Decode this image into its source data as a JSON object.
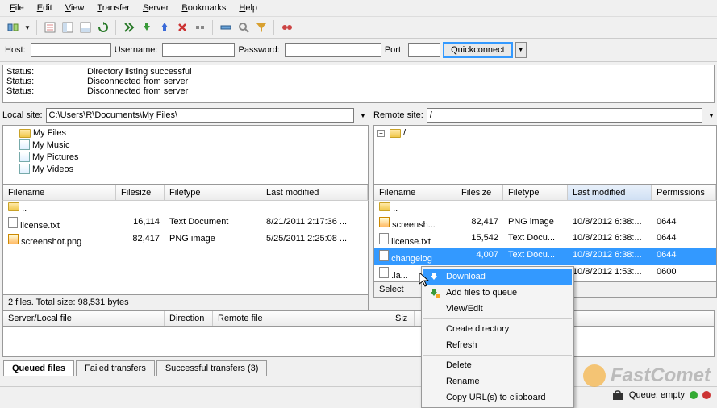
{
  "menu": [
    "File",
    "Edit",
    "View",
    "Transfer",
    "Server",
    "Bookmarks",
    "Help"
  ],
  "quickconnect": {
    "host_label": "Host:",
    "user_label": "Username:",
    "pass_label": "Password:",
    "port_label": "Port:",
    "button": "Quickconnect"
  },
  "log": [
    {
      "label": "Status:",
      "msg": "Directory listing successful"
    },
    {
      "label": "Status:",
      "msg": "Disconnected from server"
    },
    {
      "label": "Status:",
      "msg": "Disconnected from server"
    }
  ],
  "local": {
    "label": "Local site:",
    "path": "C:\\Users\\R\\Documents\\My Files\\",
    "tree": [
      "My Files",
      "My Music",
      "My Pictures",
      "My Videos"
    ],
    "cols": {
      "name": "Filename",
      "size": "Filesize",
      "type": "Filetype",
      "mod": "Last modified"
    },
    "rows": [
      {
        "name": "..",
        "size": "",
        "type": "",
        "mod": ""
      },
      {
        "name": "license.txt",
        "size": "16,114",
        "type": "Text Document",
        "mod": "8/21/2011 2:17:36 ..."
      },
      {
        "name": "screenshot.png",
        "size": "82,417",
        "type": "PNG image",
        "mod": "5/25/2011 2:25:08 ..."
      }
    ],
    "status": "2 files. Total size: 98,531 bytes"
  },
  "remote": {
    "label": "Remote site:",
    "path": "/",
    "tree_root": "/",
    "cols": {
      "name": "Filename",
      "size": "Filesize",
      "type": "Filetype",
      "mod": "Last modified",
      "perm": "Permissions"
    },
    "rows": [
      {
        "name": "..",
        "size": "",
        "type": "",
        "mod": "",
        "perm": ""
      },
      {
        "name": "screensh...",
        "size": "82,417",
        "type": "PNG image",
        "mod": "10/8/2012 6:38:...",
        "perm": "0644"
      },
      {
        "name": "license.txt",
        "size": "15,542",
        "type": "Text Docu...",
        "mod": "10/8/2012 6:38:...",
        "perm": "0644"
      },
      {
        "name": "changelog",
        "size": "4,007",
        "type": "Text Docu...",
        "mod": "10/8/2012 6:38:...",
        "perm": "0644"
      },
      {
        "name": ".la...",
        "size": "",
        "type": "",
        "mod": "10/8/2012 1:53:...",
        "perm": "0600"
      }
    ],
    "status": "Select"
  },
  "queue": {
    "cols": {
      "file": "Server/Local file",
      "dir": "Direction",
      "remote": "Remote file",
      "size": "Siz"
    },
    "tabs": [
      "Queued files",
      "Failed transfers",
      "Successful transfers (3)"
    ]
  },
  "context_menu": {
    "items": [
      "Download",
      "Add files to queue",
      "View/Edit",
      "Create directory",
      "Refresh",
      "Delete",
      "Rename",
      "Copy URL(s) to clipboard"
    ]
  },
  "footer": {
    "queue": "Queue: empty"
  },
  "watermark": "FastComet"
}
